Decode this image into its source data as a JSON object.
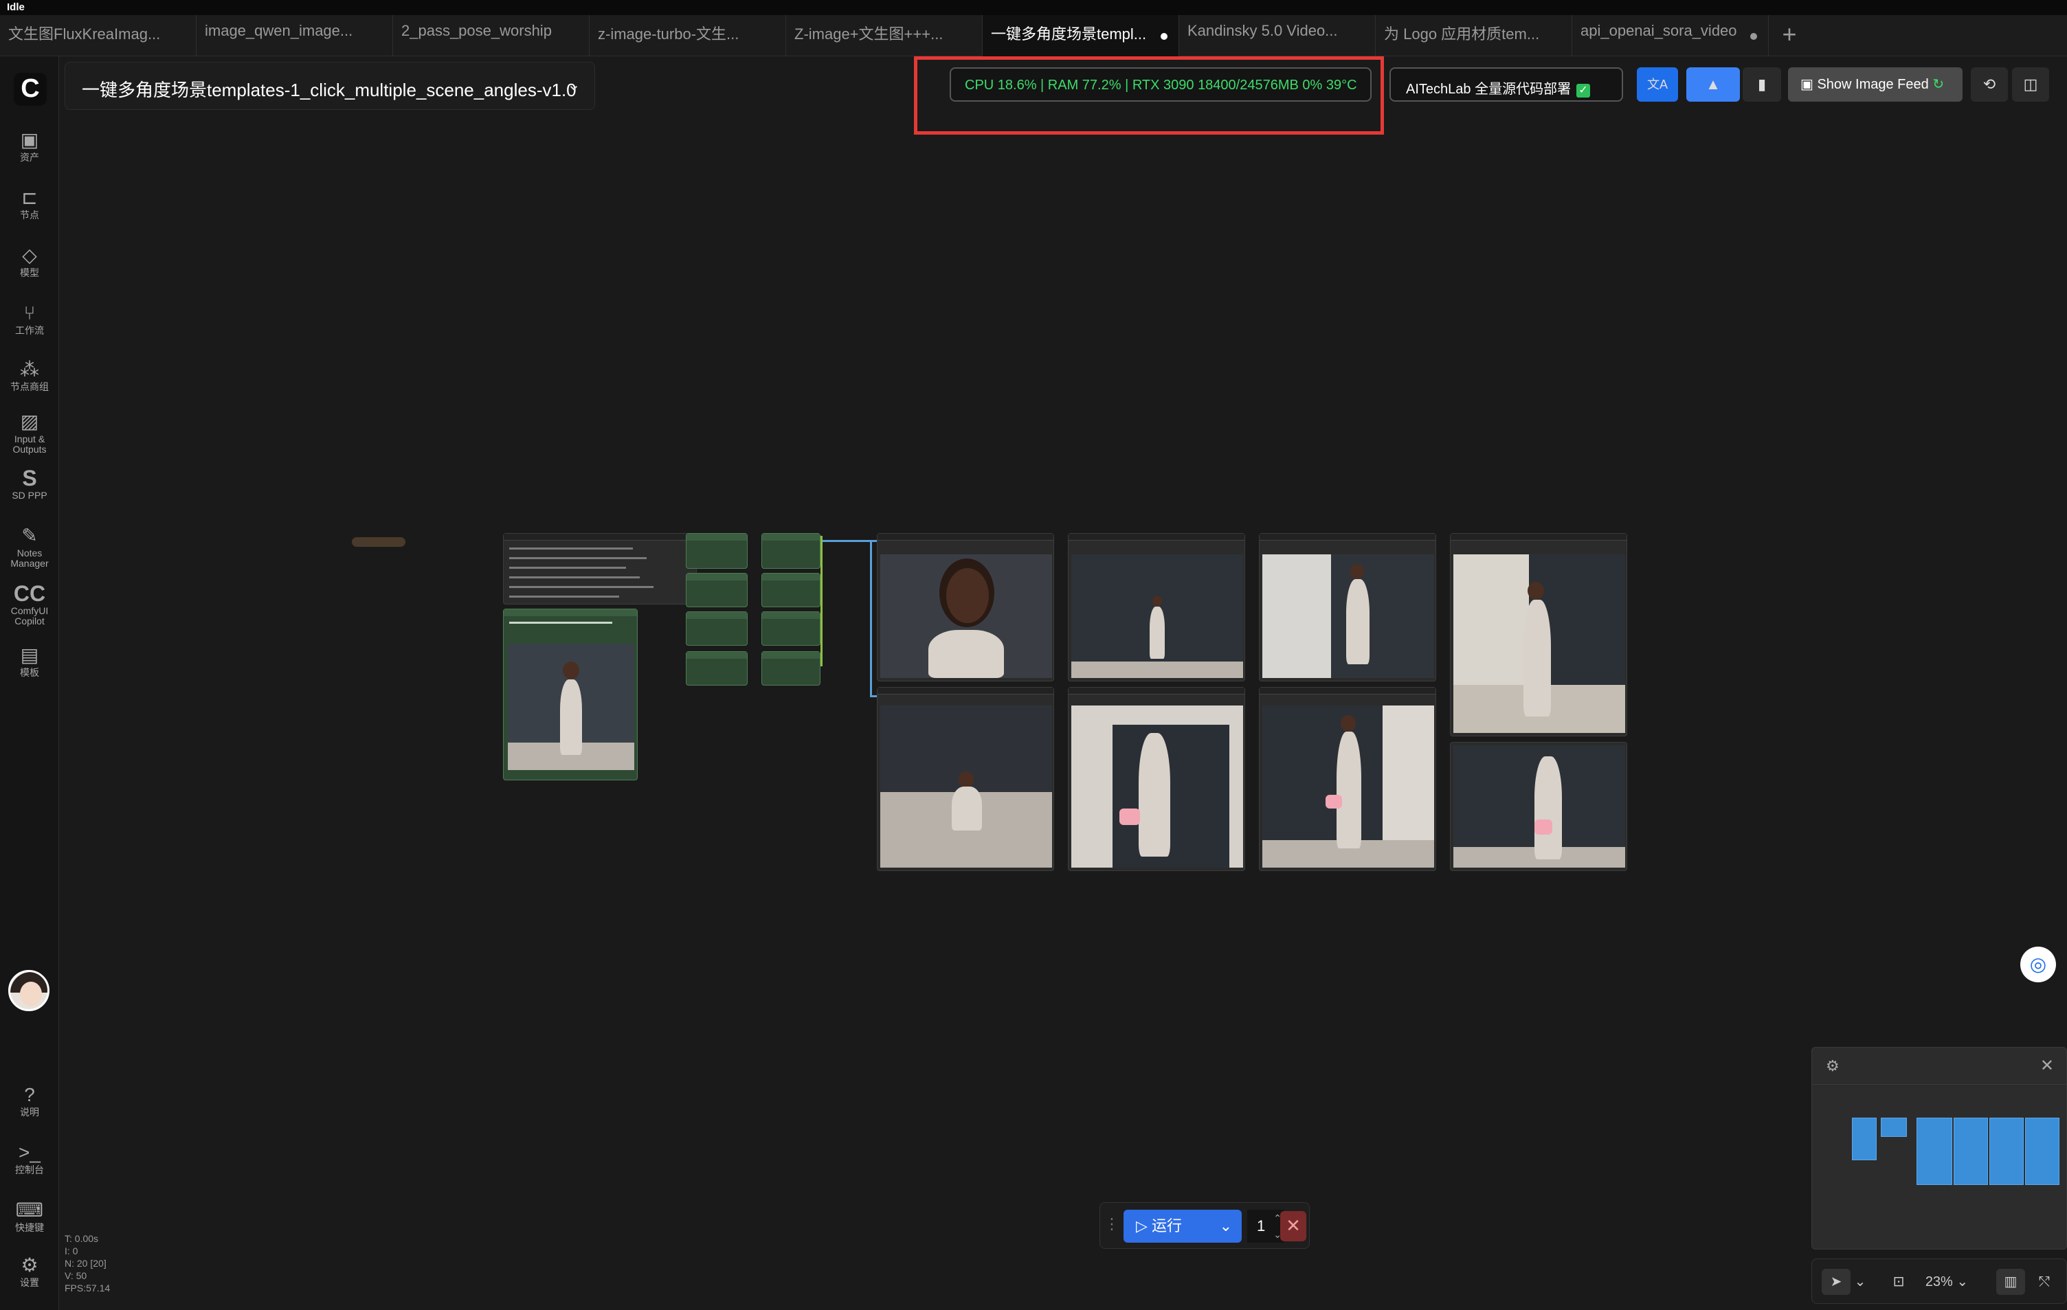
{
  "status": "Idle",
  "tabs": [
    {
      "label": "文生图FluxKreaImag..."
    },
    {
      "label": "image_qwen_image..."
    },
    {
      "label": "2_pass_pose_worship"
    },
    {
      "label": "z-image-turbo-文生..."
    },
    {
      "label": "Z-image+文生图+++..."
    },
    {
      "label": "一键多角度场景templ..."
    },
    {
      "label": "Kandinsky 5.0 Video..."
    },
    {
      "label": "为 Logo 应用材质tem..."
    },
    {
      "label": "api_openai_sora_video"
    }
  ],
  "new_tab_icon": "+",
  "sidebar": {
    "logo": "C",
    "items": [
      {
        "label": "资产",
        "icon": "▣"
      },
      {
        "label": "节点",
        "icon": "⊏"
      },
      {
        "label": "模型",
        "icon": "◇"
      },
      {
        "label": "工作流",
        "icon": "⑂"
      },
      {
        "label": "节点商组",
        "icon": "⁂"
      },
      {
        "label": "Input & Outputs",
        "icon": "▨"
      },
      {
        "label": "SD PPP",
        "icon": "S"
      },
      {
        "label": "Notes Manager",
        "icon": "✎"
      },
      {
        "label": "ComfyUI Copilot",
        "icon": "CC"
      },
      {
        "label": "模板",
        "icon": "▤"
      }
    ],
    "bottom_items": [
      {
        "label": "说明",
        "icon": "?"
      },
      {
        "label": "控制台",
        "icon": ">_"
      },
      {
        "label": "快捷键",
        "icon": "⌨"
      },
      {
        "label": "设置",
        "icon": "⚙"
      }
    ]
  },
  "workflow_title": "一键多角度场景templates-1_click_multiple_scene_angles-v1.0",
  "workflow_chevron": "⌄",
  "system_monitor": "CPU 18.6% | RAM 77.2% | RTX 3090 18400/24576MB 0% 39°C",
  "aitech_label": "AITechLab 全量源代码部署",
  "aitech_icon": "✓",
  "translate_icon": "文A",
  "bookmark_icon": "▮",
  "show_image_feed": "Show Image Feed",
  "history_icon": "⟲",
  "panel_icon": "◫",
  "run": {
    "label": "运行",
    "count": "1",
    "cancel": "✕"
  },
  "stats": [
    "T: 0.00s",
    "I: 0",
    "N: 20 [20]",
    "V: 50",
    "FPS:57.14"
  ],
  "zoom": "23%",
  "minimap_close": "✕"
}
